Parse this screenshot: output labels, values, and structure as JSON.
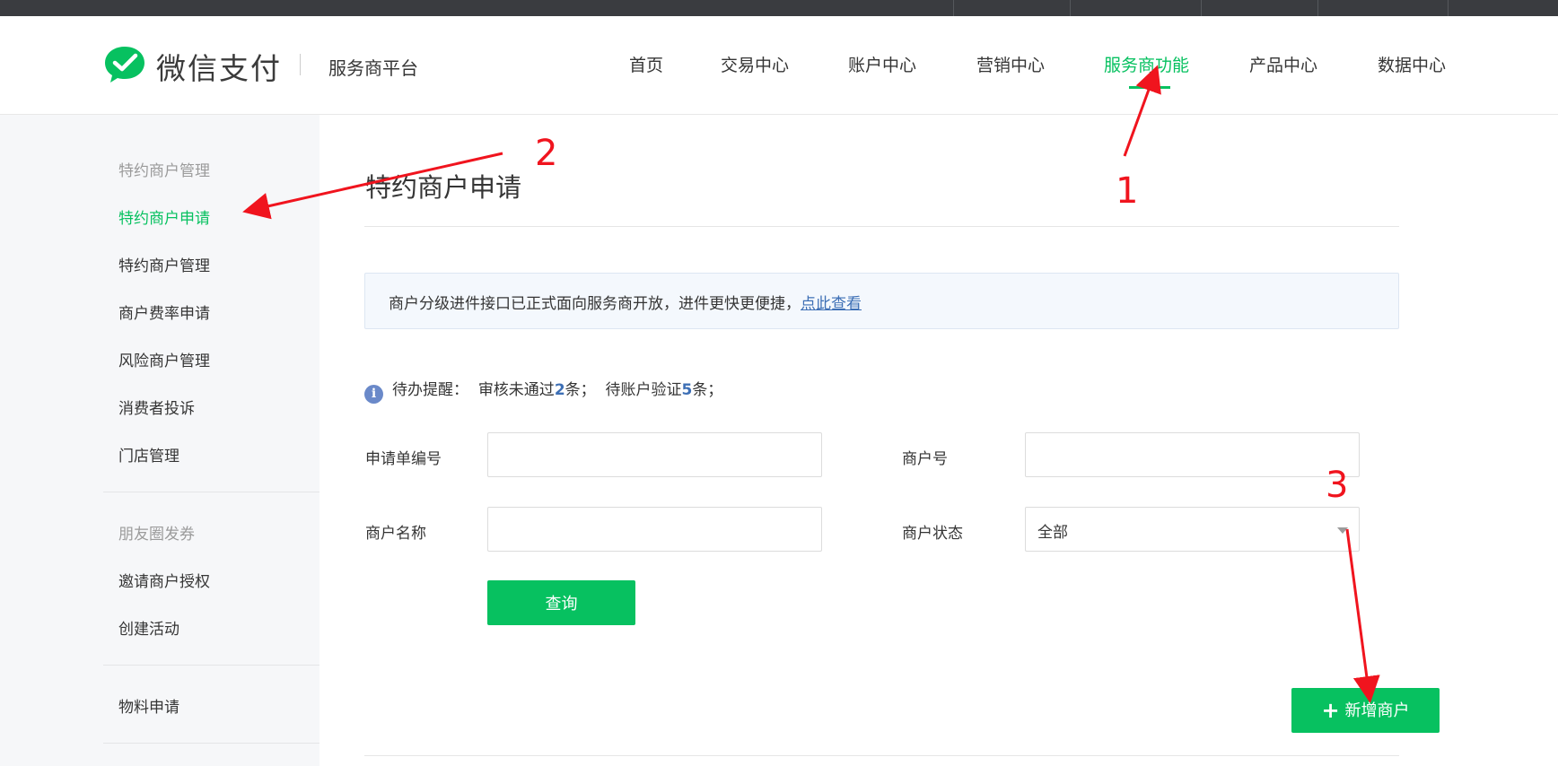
{
  "header": {
    "brand": "微信支付",
    "platform": "服务商平台",
    "nav": [
      {
        "label": "首页"
      },
      {
        "label": "交易中心"
      },
      {
        "label": "账户中心"
      },
      {
        "label": "营销中心"
      },
      {
        "label": "服务商功能"
      },
      {
        "label": "产品中心"
      },
      {
        "label": "数据中心"
      }
    ],
    "active_nav": "服务商功能"
  },
  "sidebar": {
    "groups": [
      {
        "title": "特约商户管理",
        "items": [
          "特约商户申请",
          "特约商户管理",
          "商户费率申请",
          "风险商户管理",
          "消费者投诉",
          "门店管理"
        ]
      },
      {
        "title": "朋友圈发券",
        "items": [
          "邀请商户授权",
          "创建活动"
        ]
      },
      {
        "title": "",
        "items": [
          "物料申请"
        ]
      }
    ],
    "active_item": "特约商户申请"
  },
  "main": {
    "title": "特约商户申请",
    "notice": {
      "text": "商户分级进件接口已正式面向服务商开放，进件更快更便捷，",
      "link": "点此查看"
    },
    "reminder": {
      "prefix": "待办提醒：",
      "p1": "审核未通过",
      "n1": "2",
      "s1": "条；",
      "p2": "待账户验证",
      "n2": "5",
      "s2": "条；"
    },
    "form": {
      "application_no_label": "申请单编号",
      "application_no_value": "",
      "merchant_no_label": "商户号",
      "merchant_no_value": "",
      "merchant_name_label": "商户名称",
      "merchant_name_value": "",
      "merchant_status_label": "商户状态",
      "merchant_status_value": "全部"
    },
    "query_button": "查询",
    "add_button": "新增商户"
  },
  "annotations": {
    "labels": [
      "1",
      "2",
      "3"
    ],
    "color": "#f0141e"
  },
  "colors": {
    "accent": "#07c160",
    "link": "#3d6fb5",
    "annotation": "#f0141e"
  }
}
